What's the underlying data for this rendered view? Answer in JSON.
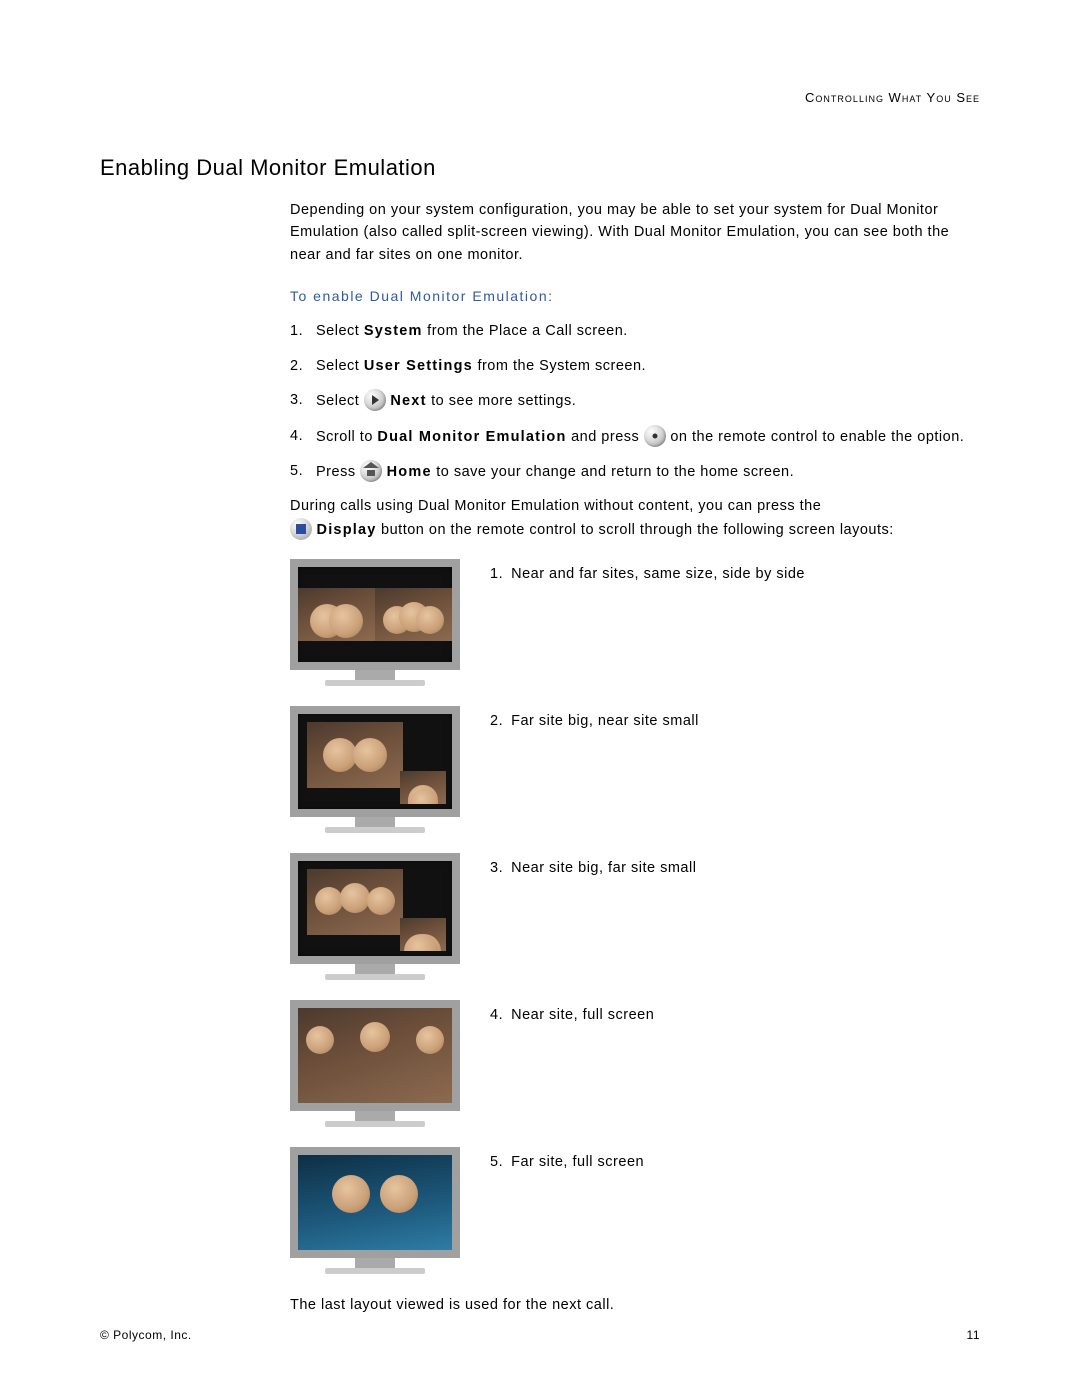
{
  "header": "Controlling What You See",
  "title": "Enabling Dual Monitor Emulation",
  "intro": "Depending on your system configuration, you may be able to set your system for Dual Monitor Emulation (also called split-screen viewing). With Dual Monitor Emulation, you can see both the near and far sites on one monitor.",
  "subhead": "To enable Dual Monitor Emulation:",
  "steps": {
    "s1": {
      "pre": "Select ",
      "bold": "System",
      "post": " from the Place a Call screen."
    },
    "s2": {
      "pre": "Select ",
      "bold": "User Settings",
      "post": " from the System screen."
    },
    "s3": {
      "pre": "Select ",
      "bold": "Next",
      "post": " to see more settings."
    },
    "s4": {
      "pre": "Scroll to ",
      "bold": "Dual Monitor Emulation",
      "mid": " and press ",
      "post": " on the remote control to enable the option."
    },
    "s5": {
      "pre": "Press ",
      "bold": "Home",
      "post": " to save your change and return to the home screen."
    }
  },
  "trailing1": "During calls using Dual Monitor Emulation without content, you can press the",
  "display_word": "Display",
  "trailing2": " button on the remote control to scroll through the following screen layouts:",
  "layouts": {
    "l1": "Near and far sites, same size, side by side",
    "l2": "Far site big, near site small",
    "l3": "Near site big, far site small",
    "l4": "Near site, full screen",
    "l5": "Far site, full screen"
  },
  "closing": "The last layout viewed is used for the next call.",
  "footer_left": "© Polycom, Inc.",
  "footer_right": "11"
}
